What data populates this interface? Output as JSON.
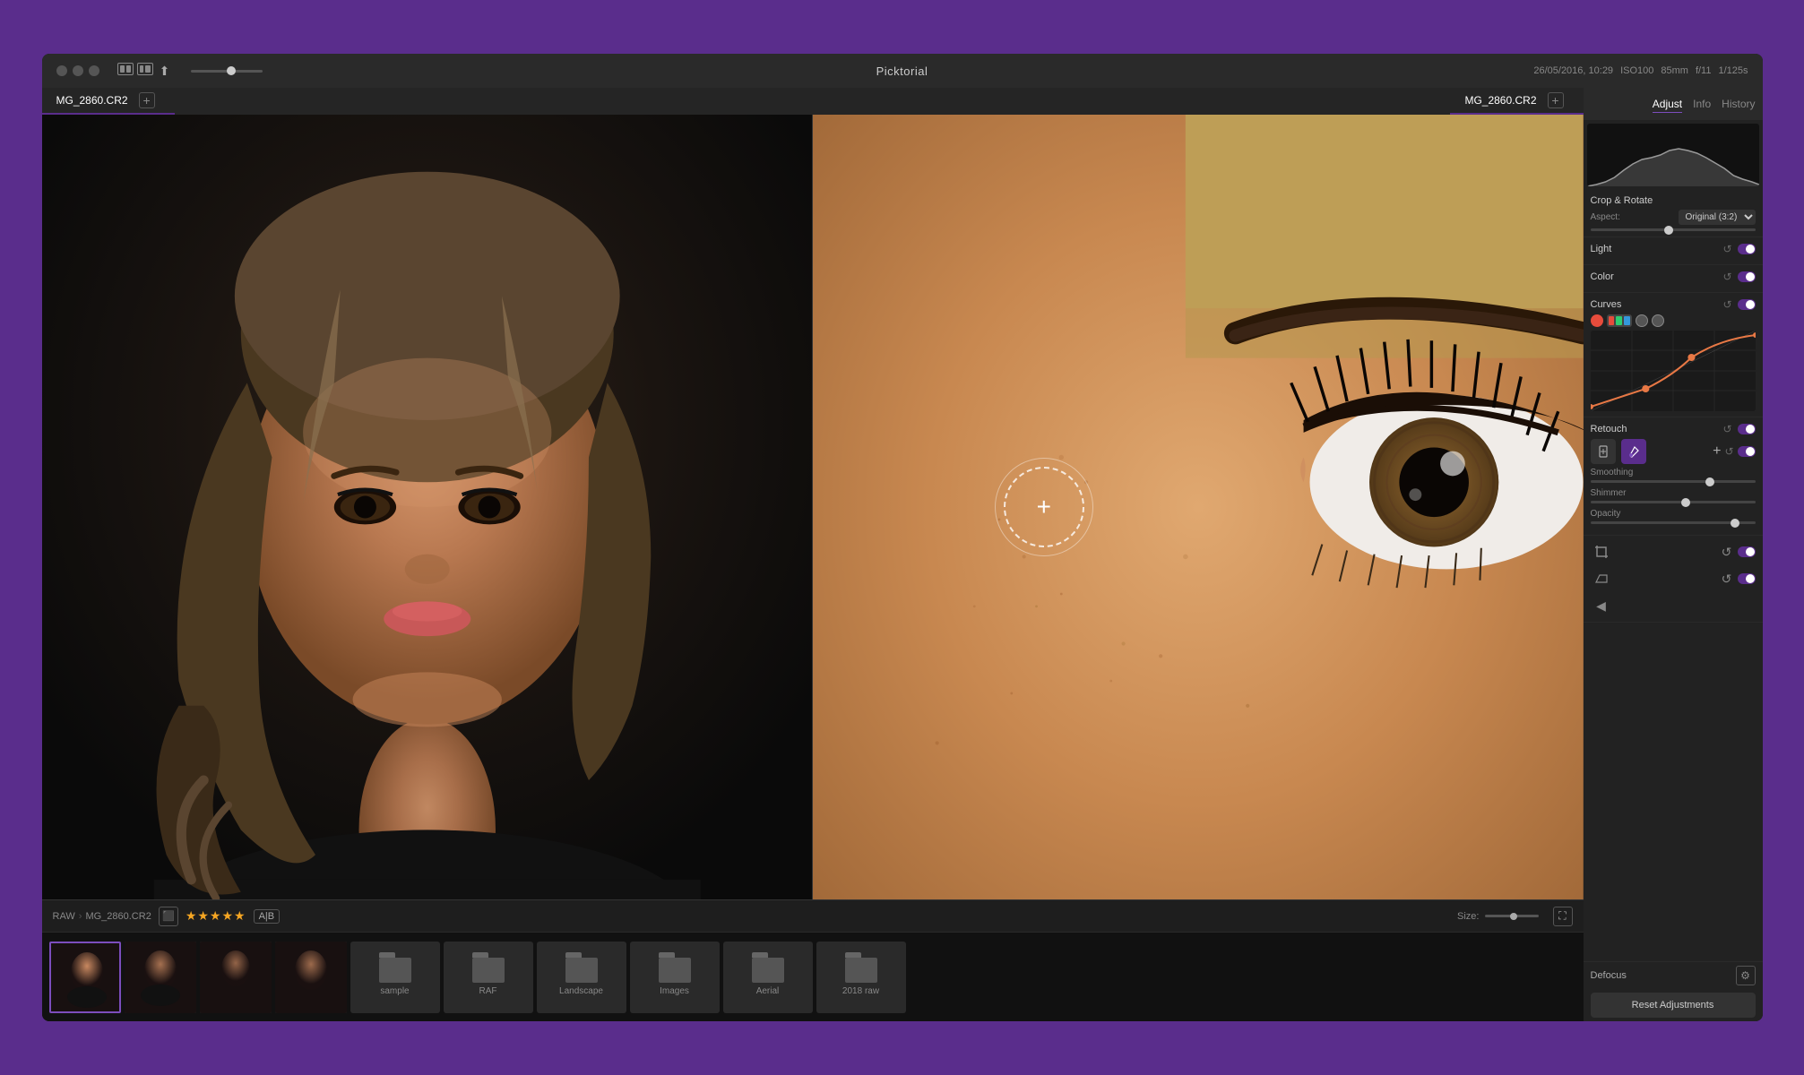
{
  "app": {
    "title": "Picktorial",
    "datetime": "26/05/2016, 10:29",
    "iso": "ISO100",
    "focal": "85mm",
    "aperture": "f/11",
    "shutter": "1/125s"
  },
  "tabs_left": [
    {
      "label": "MG_2860.CR2",
      "active": true
    },
    {
      "label": "MG_2860.CR2",
      "active": true
    }
  ],
  "panel_tabs": [
    {
      "label": "Adjust",
      "active": true
    },
    {
      "label": "Info",
      "active": false
    },
    {
      "label": "History",
      "active": false
    }
  ],
  "breadcrumb": {
    "root": "RAW",
    "file": "MG_2860.CR2"
  },
  "status": {
    "stars": "★★★★★",
    "ab": "A|B",
    "size_label": "Size:"
  },
  "adjustments": {
    "crop_label": "Crop & Rotate",
    "aspect_label": "Aspect:",
    "aspect_value": "Original (3:2)",
    "light_label": "Light",
    "color_label": "Color",
    "curves_label": "Curves",
    "retouch_label": "Retouch",
    "defocus_label": "Defocus",
    "reset_label": "Reset Adjustments",
    "sliders": {
      "smoothing_label": "Smoothing",
      "shimmer_label": "Shimmer",
      "opacity_label": "Opacity"
    }
  },
  "filmstrip": {
    "folders": [
      {
        "label": "sample"
      },
      {
        "label": "RAF"
      },
      {
        "label": "Landscape"
      },
      {
        "label": "Images"
      },
      {
        "label": "Aerial"
      },
      {
        "label": "2018 raw"
      }
    ]
  },
  "curves": {
    "dots": [
      "red",
      "all",
      "green",
      "blue"
    ]
  }
}
